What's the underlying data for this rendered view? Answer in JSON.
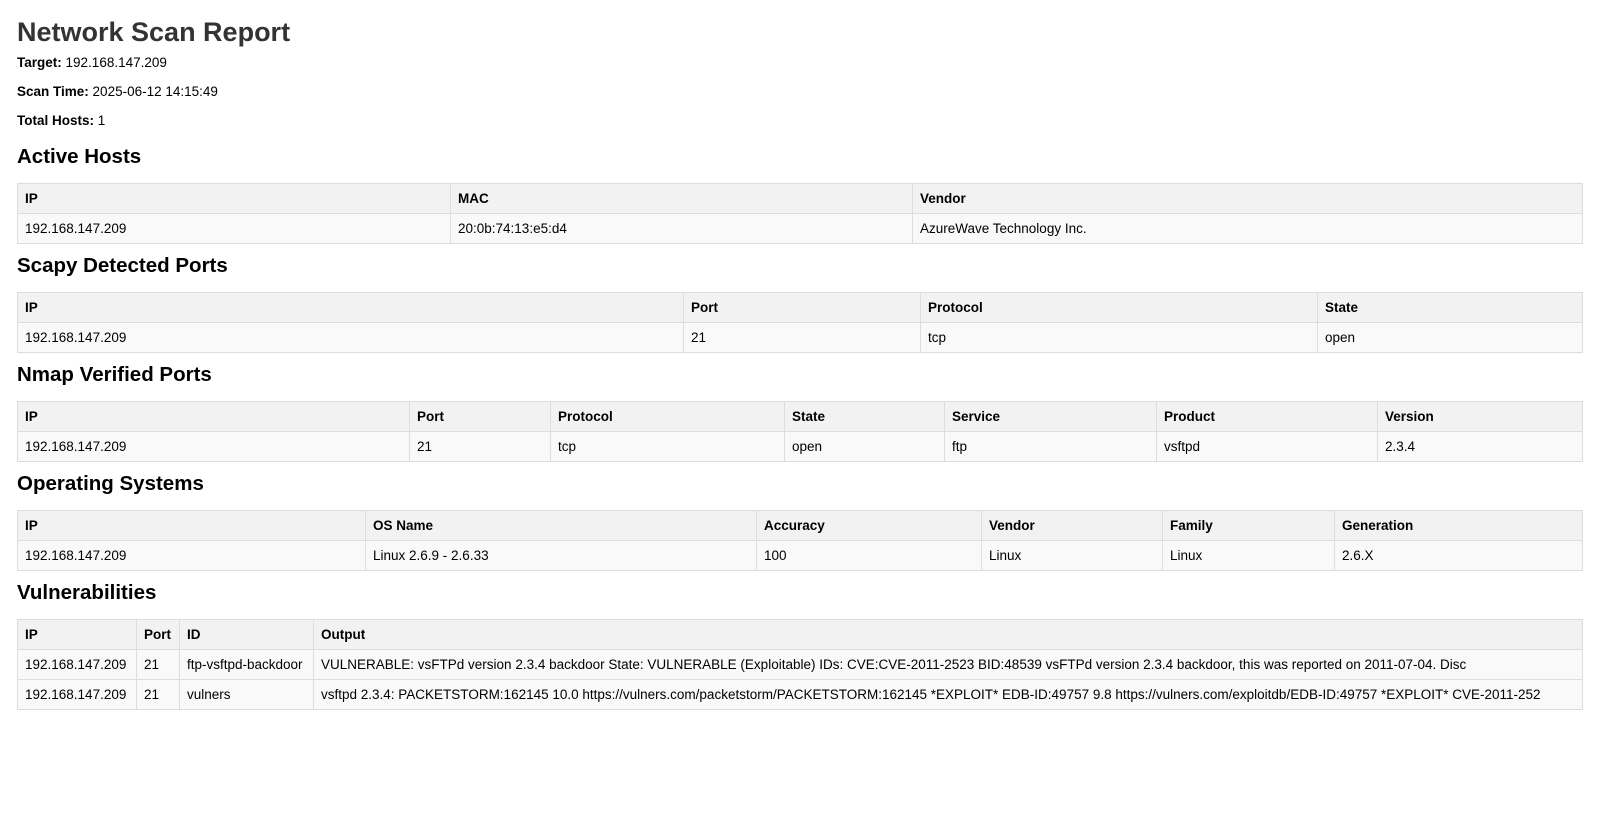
{
  "report": {
    "title": "Network Scan Report",
    "target_label": "Target:",
    "target_value": "192.168.147.209",
    "scan_time_label": "Scan Time:",
    "scan_time_value": "2025-06-12 14:15:49",
    "total_hosts_label": "Total Hosts:",
    "total_hosts_value": "1"
  },
  "active_hosts": {
    "heading": "Active Hosts",
    "columns": [
      "IP",
      "MAC",
      "Vendor"
    ],
    "rows": [
      [
        "192.168.147.209",
        "20:0b:74:13:e5:d4",
        "AzureWave Technology Inc."
      ]
    ]
  },
  "scapy_ports": {
    "heading": "Scapy Detected Ports",
    "columns": [
      "IP",
      "Port",
      "Protocol",
      "State"
    ],
    "rows": [
      [
        "192.168.147.209",
        "21",
        "tcp",
        "open"
      ]
    ]
  },
  "nmap_ports": {
    "heading": "Nmap Verified Ports",
    "columns": [
      "IP",
      "Port",
      "Protocol",
      "State",
      "Service",
      "Product",
      "Version"
    ],
    "rows": [
      [
        "192.168.147.209",
        "21",
        "tcp",
        "open",
        "ftp",
        "vsftpd",
        "2.3.4"
      ]
    ]
  },
  "operating_systems": {
    "heading": "Operating Systems",
    "columns": [
      "IP",
      "OS Name",
      "Accuracy",
      "Vendor",
      "Family",
      "Generation"
    ],
    "rows": [
      [
        "192.168.147.209",
        "Linux 2.6.9 - 2.6.33",
        "100",
        "Linux",
        "Linux",
        "2.6.X"
      ]
    ]
  },
  "vulnerabilities": {
    "heading": "Vulnerabilities",
    "columns": [
      "IP",
      "Port",
      "ID",
      "Output"
    ],
    "rows": [
      [
        "192.168.147.209",
        "21",
        "ftp-vsftpd-backdoor",
        "VULNERABLE: vsFTPd version 2.3.4 backdoor State: VULNERABLE (Exploitable) IDs: CVE:CVE-2011-2523 BID:48539 vsFTPd version 2.3.4 backdoor, this was reported on 2011-07-04. Disc"
      ],
      [
        "192.168.147.209",
        "21",
        "vulners",
        "vsftpd 2.3.4: PACKETSTORM:162145 10.0 https://vulners.com/packetstorm/PACKETSTORM:162145 *EXPLOIT* EDB-ID:49757 9.8 https://vulners.com/exploitdb/EDB-ID:49757 *EXPLOIT* CVE-2011-252"
      ]
    ]
  }
}
